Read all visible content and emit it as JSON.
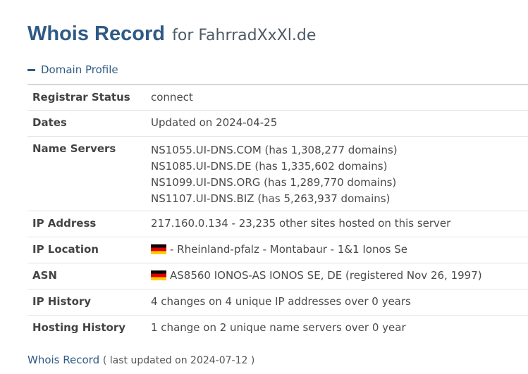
{
  "header": {
    "title": "Whois Record",
    "subtitle": "for FahrradXxXl.de"
  },
  "section": {
    "toggle_icon": "minus-icon",
    "label": "Domain Profile"
  },
  "profile": {
    "registrar_status": {
      "label": "Registrar Status",
      "value": "connect"
    },
    "dates": {
      "label": "Dates",
      "value": "Updated on 2024-04-25"
    },
    "name_servers": {
      "label": "Name Servers",
      "values": [
        "NS1055.UI-DNS.COM (has 1,308,277 domains)",
        "NS1085.UI-DNS.DE (has 1,335,602 domains)",
        "NS1099.UI-DNS.ORG (has 1,289,770 domains)",
        "NS1107.UI-DNS.BIZ (has 5,263,937 domains)"
      ]
    },
    "ip_address": {
      "label": "IP Address",
      "value": "217.160.0.134 - 23,235 other sites hosted on this server"
    },
    "ip_location": {
      "label": "IP Location",
      "flag": "germany-flag-icon",
      "value": "- Rheinland-pfalz - Montabaur - 1&1 Ionos Se"
    },
    "asn": {
      "label": "ASN",
      "flag": "germany-flag-icon",
      "value": "AS8560 IONOS-AS IONOS SE, DE (registered Nov 26, 1997)"
    },
    "ip_history": {
      "label": "IP History",
      "value": "4 changes on 4 unique IP addresses over 0 years"
    },
    "hosting_history": {
      "label": "Hosting History",
      "value": "1 change on 2 unique name servers over 0 year"
    }
  },
  "footer": {
    "link_label": "Whois Record",
    "meta": "( last updated on 2024-07-12 )"
  },
  "colors": {
    "accent": "#2f5a85",
    "text": "#4a4a4a",
    "border": "#e2e2e2"
  }
}
